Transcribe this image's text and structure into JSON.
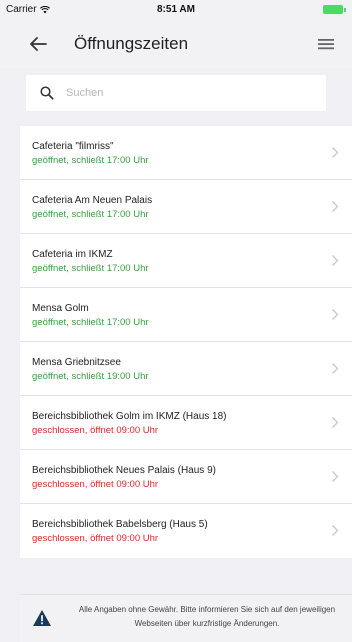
{
  "status_bar": {
    "carrier": "Carrier",
    "time": "8:51 AM"
  },
  "header": {
    "title": "Öffnungszeiten",
    "back_icon": "arrow-left-icon",
    "menu_icon": "hamburger-menu-icon"
  },
  "search": {
    "placeholder": "Suchen",
    "value": ""
  },
  "locations": [
    {
      "name": "Cafeteria \"filmriss\"",
      "status": "geöffnet, schließt 17:00 Uhr",
      "state": "open"
    },
    {
      "name": "Cafeteria Am Neuen Palais",
      "status": "geöffnet, schließt 17:00 Uhr",
      "state": "open"
    },
    {
      "name": "Cafeteria im IKMZ",
      "status": "geöffnet, schließt 17:00 Uhr",
      "state": "open"
    },
    {
      "name": "Mensa Golm",
      "status": "geöffnet, schließt 17:00 Uhr",
      "state": "open"
    },
    {
      "name": "Mensa Griebnitzsee",
      "status": "geöffnet, schließt 19:00 Uhr",
      "state": "open"
    },
    {
      "name": "Bereichsbibliothek Golm im IKMZ (Haus 18)",
      "status": "geschlossen, öffnet 09:00 Uhr",
      "state": "closed"
    },
    {
      "name": "Bereichsbibliothek Neues Palais (Haus 9)",
      "status": "geschlossen, öffnet 09:00 Uhr",
      "state": "closed"
    },
    {
      "name": "Bereichsbibliothek Babelsberg (Haus 5)",
      "status": "geschlossen, öffnet 09:00 Uhr",
      "state": "closed"
    }
  ],
  "footer": {
    "disclaimer": "Alle Angaben ohne Gewähr. Bitte informieren Sie sich auf den jeweiligen Webseiten über kurzfristige Änderungen."
  },
  "colors": {
    "open": "#3aa040",
    "closed": "#e0282e",
    "battery": "#4cd964"
  }
}
